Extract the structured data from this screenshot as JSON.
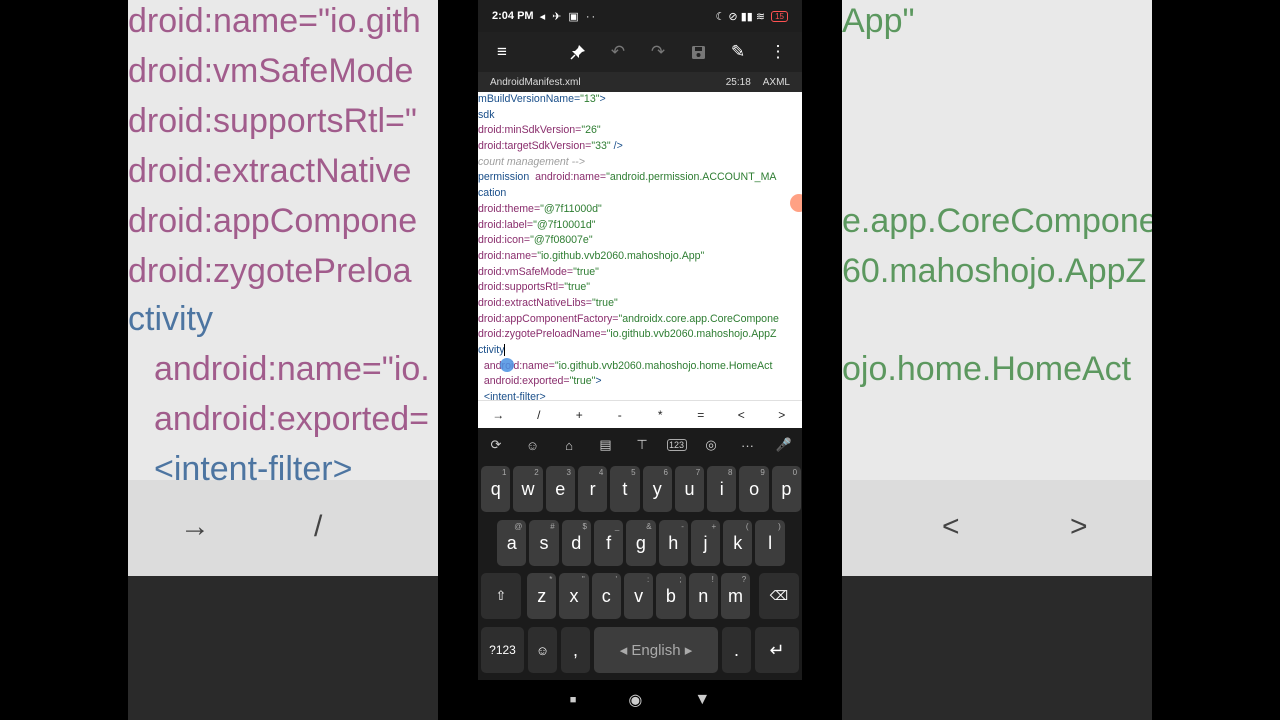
{
  "side_left": {
    "lines": [
      "droid:name=\"io.gith",
      "droid:vmSafeMode",
      "droid:supportsRtl=\"",
      "droid:extractNative",
      "droid:appCompone",
      "droid:zygotePreloa",
      "ctivity",
      "android:name=\"io.",
      "android:exported=",
      "<intent-filter>"
    ],
    "symbols": [
      "→",
      "/"
    ]
  },
  "side_right": {
    "lines": [
      "App\"",
      "e.app.CoreCompone",
      "60.mahoshojo.AppZ",
      "ojo.home.HomeAct"
    ],
    "symbols": [
      "<",
      ">"
    ]
  },
  "status": {
    "time": "2:04 PM",
    "left_icons": "◂ ✈ ▣ ··",
    "right_icons": "☾ ⊘ ▮▮ ≋",
    "battery": "15"
  },
  "toolbar": {
    "menu": "≡",
    "pin": "📌",
    "undo": "↶",
    "redo": "↷",
    "save": "💾",
    "edit": "✎",
    "more": "⋮"
  },
  "fileinfo": {
    "filename": "AndroidManifest.xml",
    "position": "25:18",
    "language": "AXML"
  },
  "code": [
    {
      "a": "",
      "t": "mBuildVersionName=",
      "s": "\"13\"",
      "r": ">"
    },
    {
      "a": "",
      "t": "sdk",
      "s": "",
      "r": ""
    },
    {
      "a": "droid:minSdkVersion=",
      "t": "",
      "s": "\"26\"",
      "r": ""
    },
    {
      "a": "droid:targetSdkVersion=",
      "t": "",
      "s": "\"33\"",
      "r": " />"
    },
    {
      "c": "count management -->"
    },
    {
      "a": "",
      "t": "permission  ",
      "a2": "android:name=",
      "s": "\"android.permission.ACCOUNT_MA",
      "r": ""
    },
    {
      "a": "",
      "t": "cation",
      "s": "",
      "r": ""
    },
    {
      "a": "droid:theme=",
      "t": "",
      "s": "\"@7f11000d\"",
      "r": ""
    },
    {
      "a": "droid:label=",
      "t": "",
      "s": "\"@7f10001d\"",
      "r": ""
    },
    {
      "a": "droid:icon=",
      "t": "",
      "s": "\"@7f08007e\"",
      "r": ""
    },
    {
      "a": "droid:name=",
      "t": "",
      "s": "\"io.github.vvb2060.mahoshojo.App\"",
      "r": ""
    },
    {
      "a": "droid:vmSafeMode=",
      "t": "",
      "s": "\"true\"",
      "r": ""
    },
    {
      "a": "droid:supportsRtl=",
      "t": "",
      "s": "\"true\"",
      "r": ""
    },
    {
      "a": "droid:extractNativeLibs=",
      "t": "",
      "s": "\"true\"",
      "r": ""
    },
    {
      "a": "droid:appComponentFactory=",
      "t": "",
      "s": "\"androidx.core.app.CoreCompone",
      "r": ""
    },
    {
      "a": "droid:zygotePreloadName=",
      "t": "",
      "s": "\"io.github.vvb2060.mahoshojo.AppZ",
      "r": ""
    },
    {
      "a": "",
      "t": "ctivity",
      "s": "",
      "r": "",
      "cursor": true
    },
    {
      "a": "  android:name=",
      "t": "",
      "s": "\"io.github.vvb2060.mahoshojo.home.HomeAct",
      "r": ""
    },
    {
      "a": "  android:exported=",
      "t": "",
      "s": "\"true\"",
      "r": ">"
    },
    {
      "a": "",
      "t": "  <intent-filter>",
      "s": "",
      "r": ""
    }
  ],
  "symbols": [
    "→",
    "/",
    "+",
    "-",
    "*",
    "=",
    "<",
    ">"
  ],
  "kb_tools": [
    "⟳",
    "☺",
    "⌂",
    "▤",
    "⊤",
    "123",
    "◎",
    "···",
    "🎤"
  ],
  "keys_row1": [
    [
      "q",
      "1"
    ],
    [
      "w",
      "2"
    ],
    [
      "e",
      "3"
    ],
    [
      "r",
      "4"
    ],
    [
      "t",
      "5"
    ],
    [
      "y",
      "6"
    ],
    [
      "u",
      "7"
    ],
    [
      "i",
      "8"
    ],
    [
      "o",
      "9"
    ],
    [
      "p",
      "0"
    ]
  ],
  "keys_row2": [
    [
      "a",
      "@"
    ],
    [
      "s",
      "#"
    ],
    [
      "d",
      "$"
    ],
    [
      "f",
      "_"
    ],
    [
      "g",
      "&"
    ],
    [
      "h",
      "-"
    ],
    [
      "j",
      "+"
    ],
    [
      "k",
      "("
    ],
    [
      "l",
      ")"
    ]
  ],
  "keys_row3": [
    [
      "z",
      "*"
    ],
    [
      "x",
      "\""
    ],
    [
      "c",
      "'"
    ],
    [
      "v",
      ":"
    ],
    [
      "b",
      ";"
    ],
    [
      "n",
      "!"
    ],
    [
      "m",
      "?"
    ]
  ],
  "key_shift": "⇧",
  "key_backspace": "⌫",
  "key_123": "?123",
  "key_emoji": "☺",
  "key_comma": ",",
  "space_label": "◂  English  ▸",
  "key_period": ".",
  "key_enter": "↵",
  "nav": {
    "back": "■",
    "home": "◉",
    "recents": "▼"
  }
}
